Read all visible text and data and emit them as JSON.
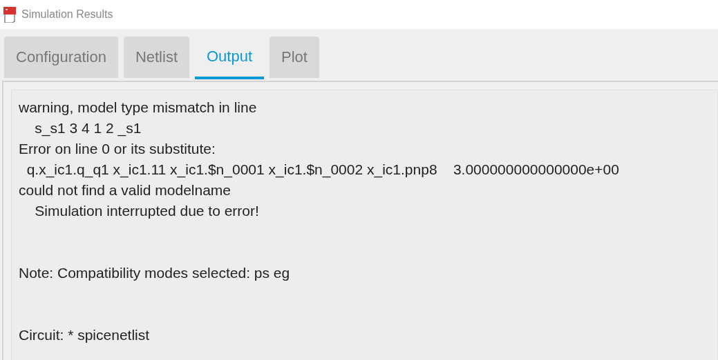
{
  "window": {
    "title": "Simulation Results"
  },
  "tabs": [
    {
      "label": "Configuration",
      "selected": false
    },
    {
      "label": "Netlist",
      "selected": false
    },
    {
      "label": "Output",
      "selected": true
    },
    {
      "label": "Plot",
      "selected": false
    }
  ],
  "output": {
    "blocks": [
      [
        "warning, model type mismatch in line",
        "    s_s1 3 4 1 2 _s1",
        "Error on line 0 or its substitute:",
        "  q.x_ic1.q_q1 x_ic1.11 x_ic1.$n_0001 x_ic1.$n_0002 x_ic1.pnp8    3.000000000000000e+00",
        "could not find a valid modelname",
        "    Simulation interrupted due to error!"
      ],
      [
        "Note: Compatibility modes selected: ps eg"
      ],
      [
        "Circuit: * spicenetlist"
      ]
    ]
  }
}
